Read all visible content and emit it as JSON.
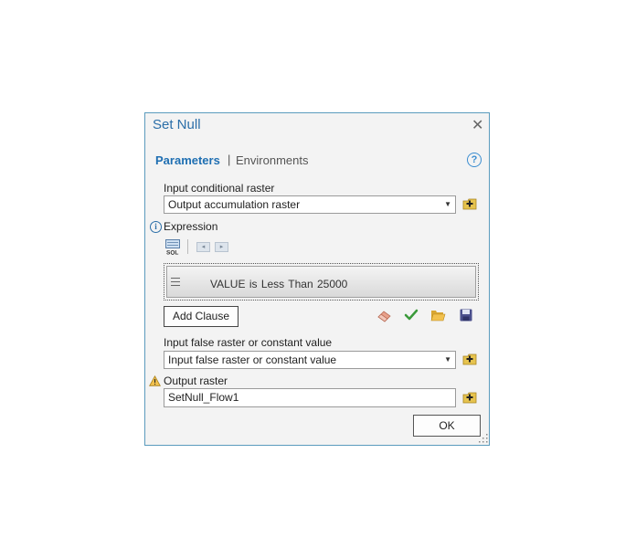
{
  "dialog": {
    "title": "Set Null",
    "close_glyph": "✕"
  },
  "tabs": {
    "parameters": "Parameters",
    "separator": "|",
    "environments": "Environments",
    "help_glyph": "?"
  },
  "input_conditional_raster": {
    "label": "Input conditional raster",
    "value": "Output accumulation raster",
    "arrow": "▼"
  },
  "expression": {
    "label": "Expression",
    "info_glyph": "i",
    "sql_icon": "sql-icon",
    "clause": {
      "field": "VALUE",
      "operator": "is Less Than",
      "value": "25000"
    },
    "add_clause_label": "Add Clause"
  },
  "input_false_raster": {
    "label": "Input false raster or constant value",
    "value": "Input false raster or constant value",
    "arrow": "▼"
  },
  "output_raster": {
    "label": "Output raster",
    "warning_icon": "warning-icon",
    "value": "SetNull_Flow1"
  },
  "ok_label": "OK",
  "colors": {
    "accent": "#1f6fb2",
    "border": "#5b9bbd",
    "folder": "#f2c14e",
    "check": "#3a9a3a",
    "save": "#4a4f8c"
  }
}
